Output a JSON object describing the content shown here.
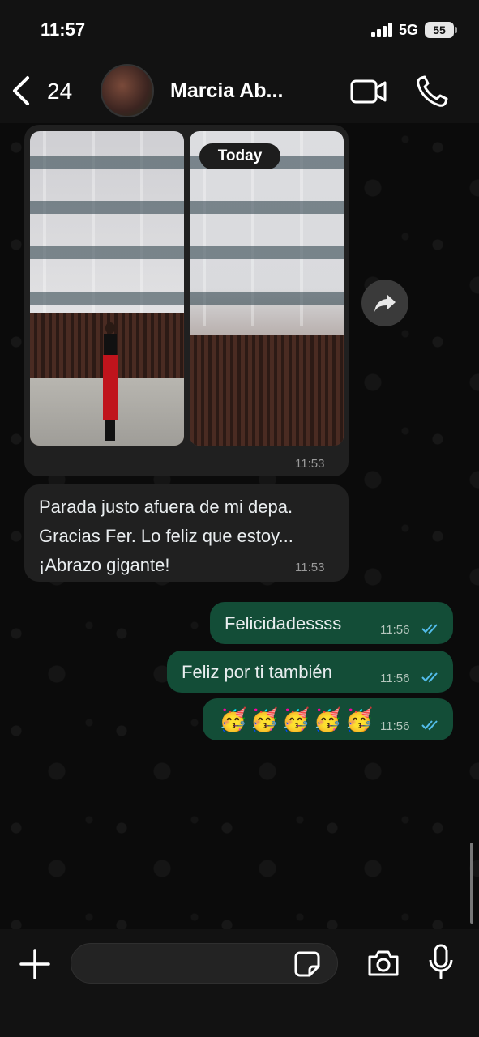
{
  "status_bar": {
    "time": "11:57",
    "network": "5G",
    "battery": "55"
  },
  "header": {
    "back_count": "24",
    "contact_name": "Marcia Ab..."
  },
  "chat": {
    "date_pill": "Today",
    "media_message": {
      "time": "11:53"
    },
    "text_message": {
      "text": "Parada justo afuera de mi depa. Gracias Fer. Lo feliz que estoy... ¡Abrazo gigante!",
      "time": "11:53"
    },
    "outgoing": [
      {
        "text": "Felicidadessss",
        "time": "11:56"
      },
      {
        "text": "Feliz por ti también",
        "time": "11:56"
      },
      {
        "text": "🥳🥳🥳🥳🥳",
        "time": "11:56"
      }
    ]
  },
  "input_bar": {
    "placeholder": ""
  },
  "colors": {
    "outgoing_bubble": "#134d37",
    "incoming_bubble": "#202020",
    "read_ticks": "#53bdeb"
  },
  "icons": [
    "back-chevron-icon",
    "video-camera-icon",
    "phone-icon",
    "forward-icon",
    "plus-icon",
    "sticker-icon",
    "camera-icon",
    "microphone-icon",
    "double-check-icon"
  ]
}
